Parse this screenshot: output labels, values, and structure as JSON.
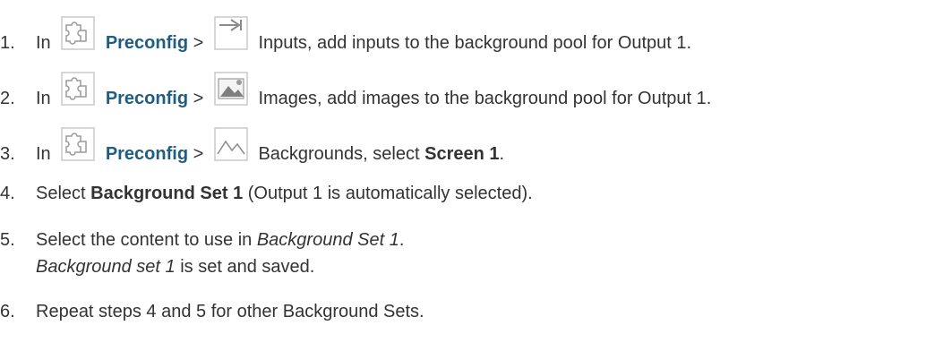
{
  "steps": [
    {
      "num": "1.",
      "in": "In",
      "link": "Preconfig",
      "sep": ">",
      "icon2": "inputs-arrow-icon",
      "rest": "Inputs, add inputs to the background pool for Output 1."
    },
    {
      "num": "2.",
      "in": "In",
      "link": "Preconfig",
      "sep": ">",
      "icon2": "images-picture-icon",
      "rest": "Images, add images to the background pool for Output 1."
    },
    {
      "num": "3.",
      "in": "In",
      "link": "Preconfig",
      "sep": ">",
      "icon2": "backgrounds-mountain-icon",
      "rest_pre": "Backgrounds, select",
      "rest_bold": "Screen 1",
      "rest_post": "."
    },
    {
      "num": "4.",
      "pre": "Select",
      "bold": "Background Set 1",
      "post": "(Output 1 is automatically selected)."
    },
    {
      "num": "5.",
      "pre": "Select the content to use in",
      "italic": "Background Set 1",
      "post": ".",
      "sub_italic": "Background set 1",
      "sub_post": "is set and saved."
    },
    {
      "num": "6.",
      "text": "Repeat steps 4 and 5 for other Background Sets."
    }
  ],
  "icons": {
    "preconfig": "puzzle-icon",
    "color_icon_stroke": "#9a9a9a",
    "color_link": "#1f5d82"
  }
}
